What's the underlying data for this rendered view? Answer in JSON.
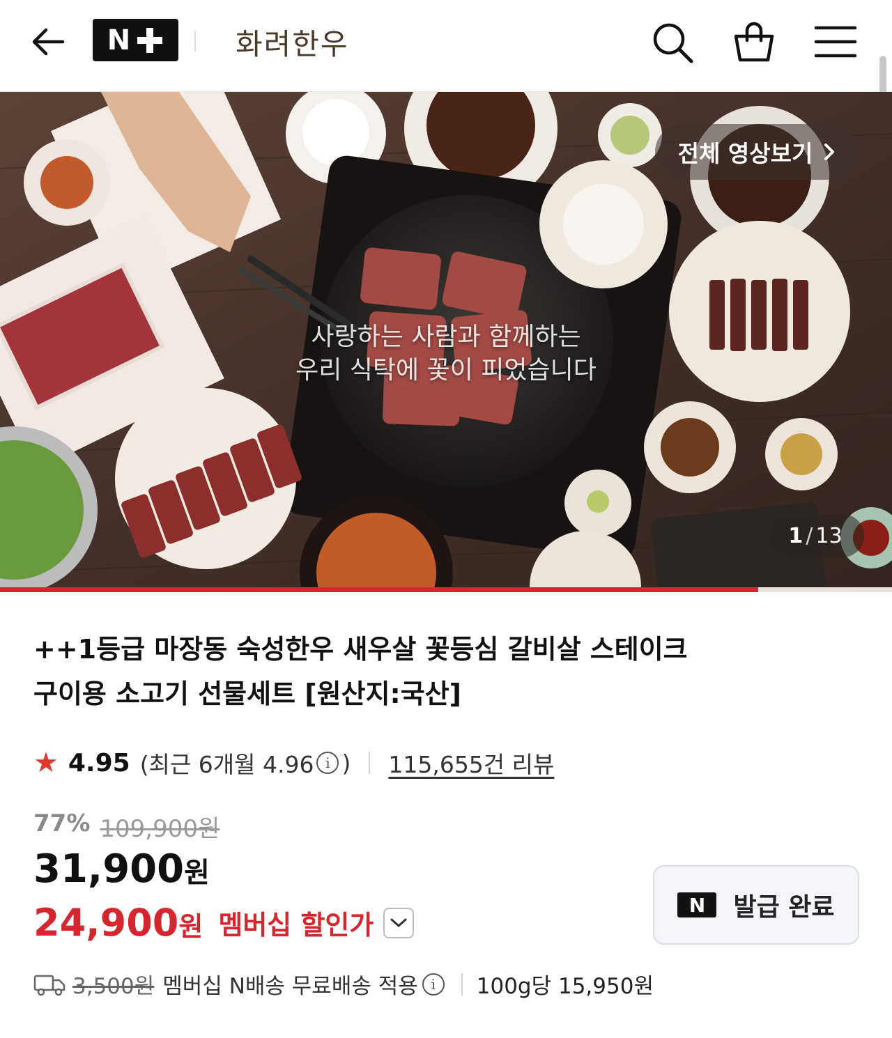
{
  "header": {
    "back_icon": "arrow-left-icon",
    "logo_text": "N",
    "logo_plus": "+",
    "store_name": "화려한우",
    "icons": [
      "search-icon",
      "shopping-bag-icon",
      "menu-icon"
    ]
  },
  "hero": {
    "video_button_label": "전체 영상보기",
    "caption_line1": "사랑하는 사람과 함께하는",
    "caption_line2": "우리 식탁에 꽃이 피었습니다",
    "counter_current": "1",
    "counter_sep": "/",
    "counter_total": "13",
    "progress": 0.85
  },
  "product": {
    "title_line1": "++1등급 마장동 숙성한우 새우살 꽃등심 갈비살 스테이크",
    "title_line2": "구이용 소고기 선물세트 [원산지:국산]",
    "rating": "4.95",
    "recent_prefix": "(최근 6개월 4.96",
    "recent_suffix": ")",
    "review_count": "115,655건 리뷰",
    "discount_rate": "77%",
    "original_price": "109,900원",
    "price_number": "31,900",
    "price_unit": "원",
    "member_price_number": "24,900",
    "member_price_unit": "원",
    "member_label": "멤버십 할인가",
    "coupon_badge": "N",
    "coupon_label": "발급 완료",
    "shipping_original": "3,500원",
    "shipping_text": "멤버십 N배송 무료배송 적용",
    "per_100g": "100g당 15,950원"
  },
  "colors": {
    "accent_red": "#d4262f",
    "star": "#e03b2f"
  }
}
